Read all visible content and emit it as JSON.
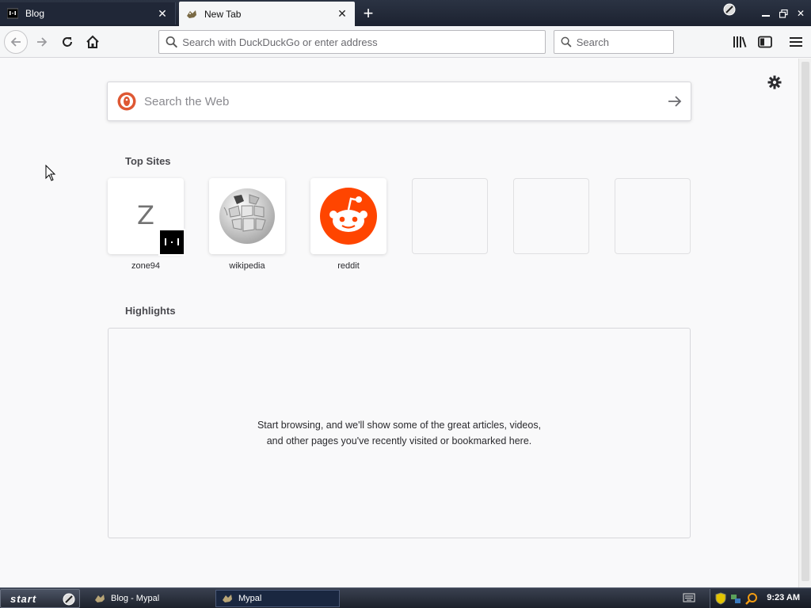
{
  "tabs": [
    {
      "label": "Blog",
      "active": false
    },
    {
      "label": "New Tab",
      "active": true
    }
  ],
  "navbar": {
    "url_placeholder": "Search with DuckDuckGo or enter address",
    "search_placeholder": "Search"
  },
  "newtab": {
    "websearch_placeholder": "Search the Web",
    "topsites_title": "Top Sites",
    "topsites": [
      {
        "label": "zone94",
        "icon": "zone94-letter-icon",
        "letter": "Z"
      },
      {
        "label": "wikipedia",
        "icon": "wikipedia-globe-icon"
      },
      {
        "label": "reddit",
        "icon": "reddit-alien-icon"
      },
      {
        "label": "",
        "icon": ""
      },
      {
        "label": "",
        "icon": ""
      },
      {
        "label": "",
        "icon": ""
      }
    ],
    "highlights_title": "Highlights",
    "highlights_message": "Start browsing, and we'll show some of the great articles, videos, and other pages you've recently visited or bookmarked here."
  },
  "taskbar": {
    "start_label": "start",
    "tasks": [
      {
        "label": "Blog - Mypal",
        "active": false
      },
      {
        "label": "Mypal",
        "active": true
      }
    ],
    "clock": "9:23 AM"
  },
  "colors": {
    "tabstrip": "#1c2230",
    "toolbar": "#f5f6f7",
    "page": "#f9f9fa",
    "reddit": "#ff4500",
    "duckduckgo": "#de5833"
  }
}
